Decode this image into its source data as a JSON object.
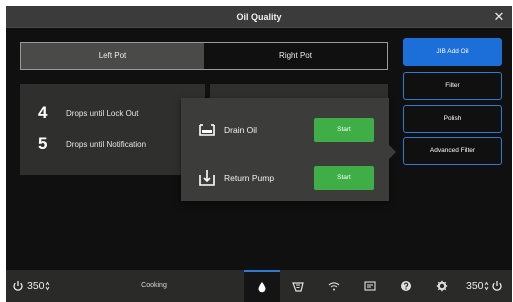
{
  "window": {
    "title": "Oil Quality"
  },
  "icons": {
    "close": "close-icon"
  },
  "pot_tabs": [
    {
      "label": "Left Pot",
      "active": true
    },
    {
      "label": "Right Pot",
      "active": false
    }
  ],
  "drops": [
    {
      "count": "4",
      "label": "Drops until Lock Out"
    },
    {
      "count": "5",
      "label": "Drops until Notification"
    }
  ],
  "popup": {
    "rows": [
      {
        "label": "Drain Oil",
        "icon": "drain-oil-icon",
        "button": "Start"
      },
      {
        "label": "Return Pump",
        "icon": "return-pump-icon",
        "button": "Start"
      }
    ]
  },
  "side_buttons": [
    {
      "label": "JIB Add Oil",
      "primary": true
    },
    {
      "label": "Filter",
      "primary": false
    },
    {
      "label": "Polish",
      "primary": false
    },
    {
      "label": "Advanced Filter",
      "primary": false
    }
  ],
  "bottom_bar": {
    "left_temp": "350",
    "status": "Cooking",
    "right_temp": "350",
    "nav": [
      {
        "icon": "oil-drop-icon",
        "active": true
      },
      {
        "icon": "fryer-basket-icon",
        "active": false
      },
      {
        "icon": "wifi-icon",
        "active": false
      },
      {
        "icon": "manual-icon",
        "active": false
      },
      {
        "icon": "help-icon",
        "active": false
      },
      {
        "icon": "settings-gear-icon",
        "active": false
      }
    ]
  },
  "colors": {
    "accent_blue": "#1c6fd8",
    "start_green": "#3fae47",
    "panel": "#2f302e",
    "popup": "#3c3d3b"
  }
}
